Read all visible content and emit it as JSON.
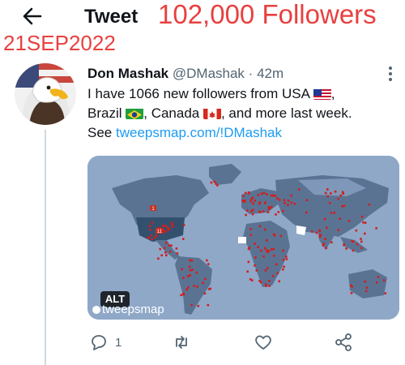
{
  "header": {
    "title": "Tweet"
  },
  "overlay": {
    "followers": "102,000 Followers",
    "date": "21SEP2022"
  },
  "tweet": {
    "author_name": "Don Mashak",
    "handle": "@DMashak",
    "separator": "·",
    "time": "42m",
    "text_line1": "I have 1066 new followers from USA",
    "text_line2_a": "Brazil",
    "text_line2_b": ", Canada",
    "text_line2_c": ", and more last week.",
    "text_line3_prefix": "See",
    "link": "tweepsmap.com/!DMashak",
    "media": {
      "alt_badge": "ALT",
      "logo_text": "tweepsmap",
      "map_label_1": "1",
      "map_label_2": "11"
    },
    "actions": {
      "reply_count": "1"
    }
  },
  "colors": {
    "accent": "#1d9bf0",
    "overlay_red": "#e8403f",
    "muted": "#536471",
    "map_water": "#8fa8c8",
    "map_land": "#5b7393",
    "map_usa": "#34506f",
    "marker": "#d11f1f"
  },
  "icons": {
    "back": "arrow-left-icon",
    "more": "more-vertical-icon",
    "reply": "reply-icon",
    "retweet": "retweet-icon",
    "like": "heart-icon",
    "share": "share-icon",
    "flags": [
      "flag-usa-icon",
      "flag-brazil-icon",
      "flag-canada-icon"
    ]
  }
}
